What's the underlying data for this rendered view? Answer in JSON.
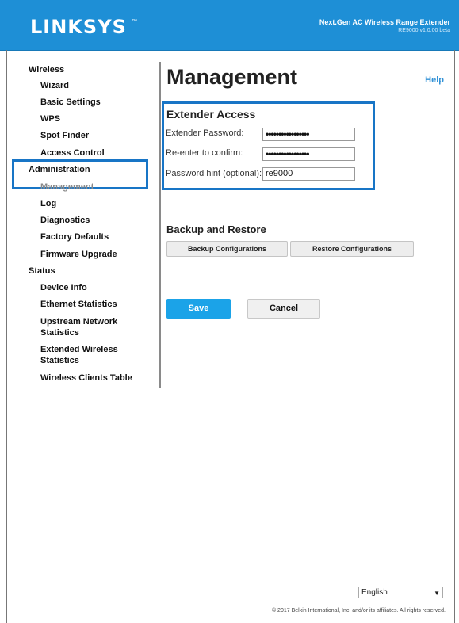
{
  "header": {
    "brand": "LINKSYS",
    "trademark": "™",
    "product": "Next.Gen AC Wireless Range Extender",
    "version": "RE9000 v1.0.00 beta",
    "accent_color": "#1e8fd6"
  },
  "sidebar": {
    "groups": [
      {
        "label": "Wireless",
        "items": [
          "Wizard",
          "Basic Settings",
          "WPS",
          "Spot Finder",
          "Access Control"
        ]
      },
      {
        "label": "Administration",
        "items": [
          "Management",
          "Log",
          "Diagnostics",
          "Factory Defaults",
          "Firmware Upgrade"
        ]
      },
      {
        "label": "Status",
        "items": [
          "Device Info",
          "Ethernet Statistics",
          "Upstream Network Statistics",
          "Extended Wireless Statistics",
          "Wireless Clients Table"
        ]
      }
    ],
    "active_item": "Management"
  },
  "main": {
    "title": "Management",
    "help_label": "Help",
    "extender_access": {
      "title": "Extender Access",
      "password_label": "Extender Password:",
      "password_value": "•••••••••••••••••",
      "confirm_label": "Re-enter to confirm:",
      "confirm_value": "•••••••••••••••••",
      "hint_label": "Password hint (optional):",
      "hint_value": "re9000"
    },
    "backup": {
      "title": "Backup and Restore",
      "backup_label": "Backup Configurations",
      "restore_label": "Restore Configurations"
    },
    "save_label": "Save",
    "cancel_label": "Cancel"
  },
  "footer": {
    "language": "English",
    "copyright": "© 2017 Belkin International, Inc. and/or its affiliates. All rights reserved."
  }
}
